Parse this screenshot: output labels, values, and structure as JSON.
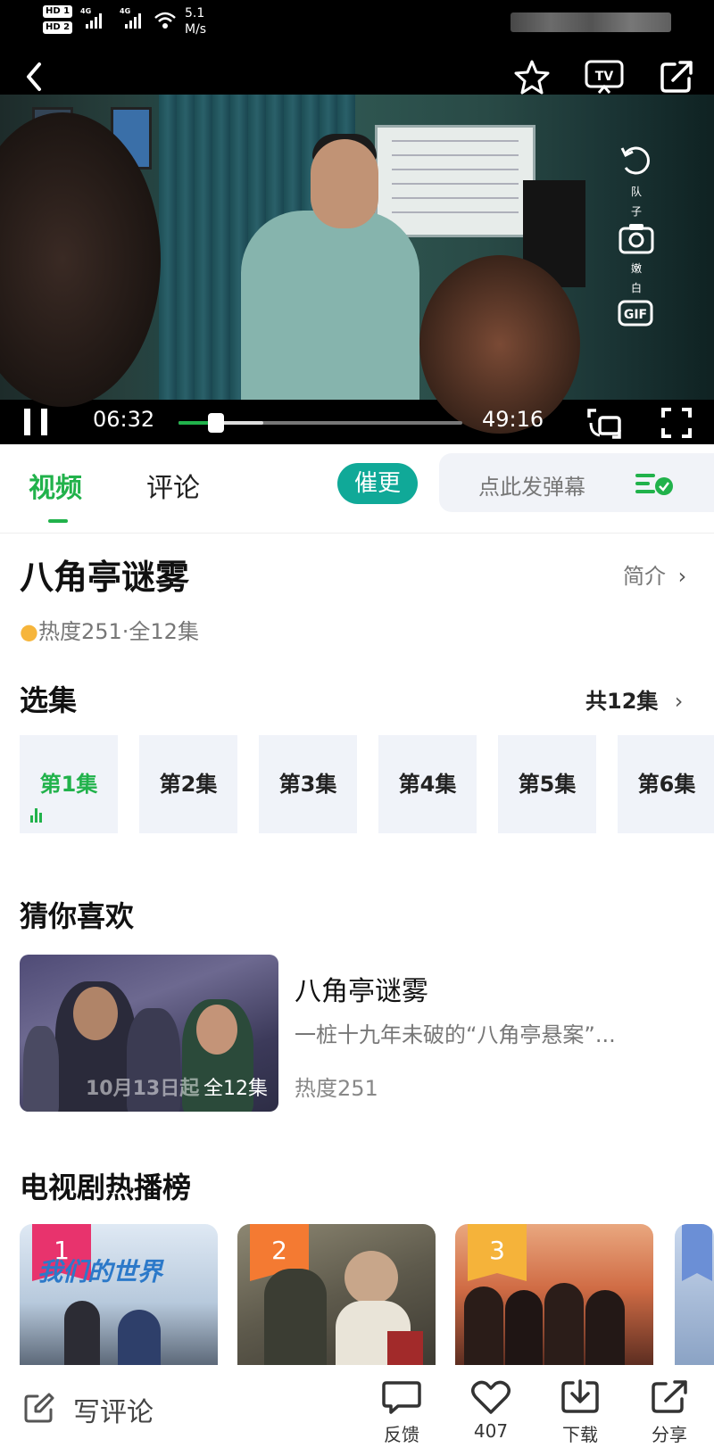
{
  "status_bar": {
    "hd1": "HD 1",
    "hd2": "HD 2",
    "net1": "4G",
    "net2": "4G",
    "speed_value": "5.1",
    "speed_unit": "M/s"
  },
  "player": {
    "current_time": "06:32",
    "total_time": "49:16",
    "progress": 0.133,
    "buffered": 0.3,
    "side_label_1": "队",
    "side_label_2": "子",
    "side_label_3": "嫩",
    "side_label_4": "白"
  },
  "tabs": {
    "video": "视频",
    "comments": "评论",
    "urge_label": "催更",
    "danmaku_placeholder": "点此发弹幕"
  },
  "show": {
    "title": "八角亭谜雾",
    "intro_label": "简介",
    "heat": "热度251",
    "episodes_total_short": "全12集"
  },
  "episodes": {
    "section_title": "选集",
    "total_label": "共12集",
    "items": [
      "第1集",
      "第2集",
      "第3集",
      "第4集",
      "第5集",
      "第6集"
    ]
  },
  "recommend": {
    "section_title": "猜你喜欢",
    "item": {
      "title": "八角亭谜雾",
      "description": "一桩十九年未破的“八角亭悬案”...",
      "heat": "热度251",
      "overlay_date": "10月13日起",
      "overlay_episodes": "全12集"
    }
  },
  "ranking": {
    "section_title": "电视剧热播榜",
    "items": [
      {
        "rank": "1",
        "badge_color": "#e8336d",
        "poster_title": "我们的世界"
      },
      {
        "rank": "2",
        "badge_color": "#f47a32",
        "poster_title": ""
      },
      {
        "rank": "3",
        "badge_color": "#f5b33a",
        "poster_title": ""
      }
    ]
  },
  "bottom_bar": {
    "write_comment": "写评论",
    "feedback": "反馈",
    "likes": "407",
    "download": "下载",
    "share": "分享"
  },
  "colors": {
    "accent_green": "#21b24b",
    "urge_teal": "#10a998",
    "rank1": "#e8336d",
    "rank2": "#f47a32",
    "rank3": "#f5b33a"
  }
}
